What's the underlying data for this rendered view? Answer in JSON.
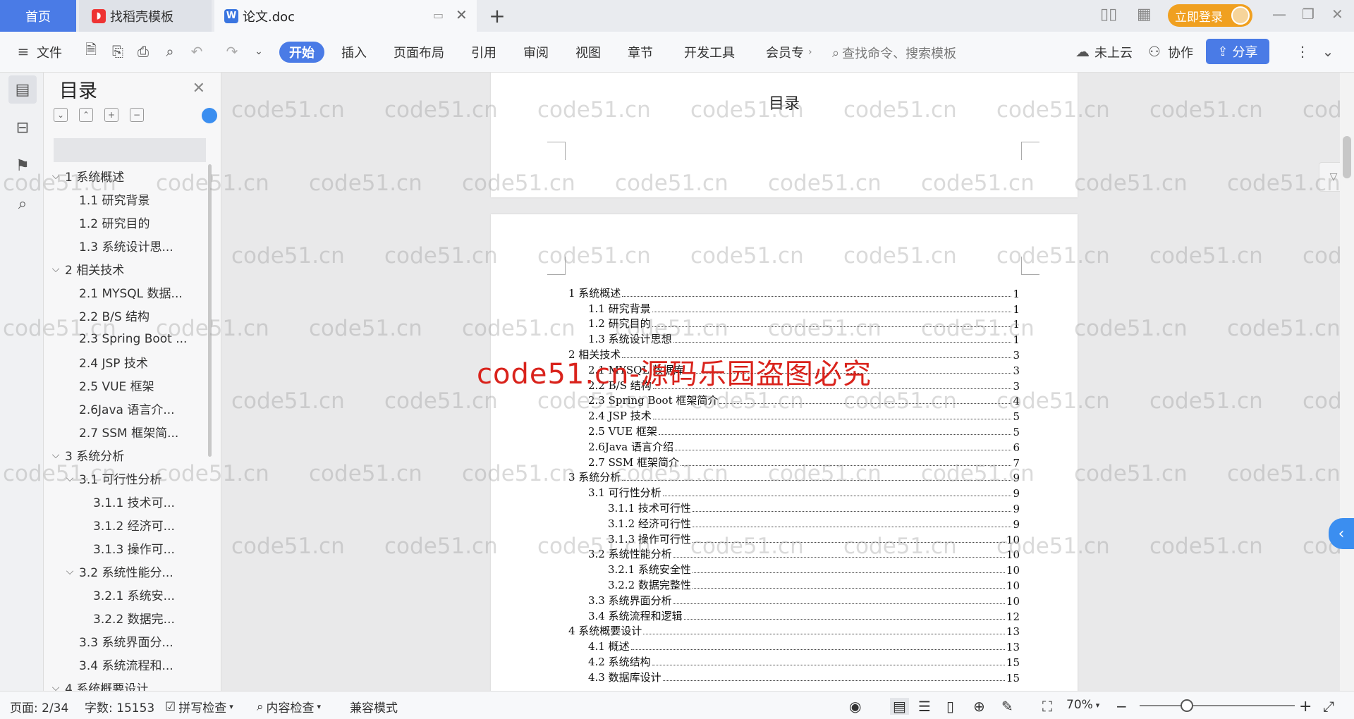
{
  "tabs": {
    "home": "首页",
    "daoke": "找稻壳模板",
    "doc": "论文.doc",
    "add": "+"
  },
  "header": {
    "login": "立即登录"
  },
  "toolbar": {
    "file": "文件",
    "menus": [
      "开始",
      "插入",
      "页面布局",
      "引用",
      "审阅",
      "视图",
      "章节",
      "开发工具",
      "会员专"
    ],
    "search_placeholder": "查找命令、搜索模板",
    "cloud": "未上云",
    "collab": "协作",
    "share": "分享"
  },
  "sidebar": {
    "title": "目录",
    "items": [
      {
        "label": "1 系统概述",
        "level": 1,
        "arrow": "⌵"
      },
      {
        "label": "1.1 研究背景",
        "level": 2,
        "arrow": ""
      },
      {
        "label": "1.2 研究目的",
        "level": 2,
        "arrow": ""
      },
      {
        "label": "1.3 系统设计思...",
        "level": 2,
        "arrow": ""
      },
      {
        "label": "2 相关技术",
        "level": 1,
        "arrow": "⌵"
      },
      {
        "label": "2.1 MYSQL 数据...",
        "level": 2,
        "arrow": ""
      },
      {
        "label": "2.2 B/S 结构",
        "level": 2,
        "arrow": ""
      },
      {
        "label": "2.3 Spring Boot ...",
        "level": 2,
        "arrow": ""
      },
      {
        "label": "2.4 JSP 技术",
        "level": 2,
        "arrow": ""
      },
      {
        "label": "2.5 VUE 框架",
        "level": 2,
        "arrow": ""
      },
      {
        "label": "2.6Java 语言介...",
        "level": 2,
        "arrow": ""
      },
      {
        "label": "2.7 SSM 框架简...",
        "level": 2,
        "arrow": ""
      },
      {
        "label": "3 系统分析",
        "level": 1,
        "arrow": "⌵"
      },
      {
        "label": "3.1 可行性分析",
        "level": 2,
        "arrow": "⌵"
      },
      {
        "label": "3.1.1 技术可...",
        "level": 3,
        "arrow": ""
      },
      {
        "label": "3.1.2 经济可...",
        "level": 3,
        "arrow": ""
      },
      {
        "label": "3.1.3 操作可...",
        "level": 3,
        "arrow": ""
      },
      {
        "label": "3.2 系统性能分...",
        "level": 2,
        "arrow": "⌵"
      },
      {
        "label": "3.2.1 系统安...",
        "level": 3,
        "arrow": ""
      },
      {
        "label": "3.2.2 数据完...",
        "level": 3,
        "arrow": ""
      },
      {
        "label": "3.3 系统界面分...",
        "level": 2,
        "arrow": ""
      },
      {
        "label": "3.4 系统流程和...",
        "level": 2,
        "arrow": ""
      },
      {
        "label": "4 系统概要设计",
        "level": 1,
        "arrow": "⌵"
      }
    ]
  },
  "document": {
    "page1_title": "目录",
    "toc": [
      {
        "text": "1 系统概述",
        "page": "1",
        "indent": 0
      },
      {
        "text": "1.1 研究背景",
        "page": "1",
        "indent": 1
      },
      {
        "text": "1.2 研究目的",
        "page": "1",
        "indent": 1
      },
      {
        "text": "1.3 系统设计思想",
        "page": "1",
        "indent": 1
      },
      {
        "text": "2 相关技术",
        "page": "3",
        "indent": 0
      },
      {
        "text": "2.1 MYSQL 数据库",
        "page": "3",
        "indent": 1
      },
      {
        "text": "2.2 B/S 结构",
        "page": "3",
        "indent": 1
      },
      {
        "text": "2.3 Spring Boot 框架简介",
        "page": "4",
        "indent": 1
      },
      {
        "text": "2.4 JSP 技术",
        "page": "5",
        "indent": 1
      },
      {
        "text": "2.5 VUE 框架",
        "page": "5",
        "indent": 1
      },
      {
        "text": "2.6Java 语言介绍",
        "page": "6",
        "indent": 1
      },
      {
        "text": "2.7 SSM 框架简介",
        "page": "7",
        "indent": 1
      },
      {
        "text": "3 系统分析",
        "page": "9",
        "indent": 0
      },
      {
        "text": "3.1 可行性分析",
        "page": "9",
        "indent": 1
      },
      {
        "text": "3.1.1 技术可行性",
        "page": "9",
        "indent": 2
      },
      {
        "text": "3.1.2 经济可行性",
        "page": "9",
        "indent": 2
      },
      {
        "text": "3.1.3 操作可行性",
        "page": "10",
        "indent": 2
      },
      {
        "text": "3.2 系统性能分析",
        "page": "10",
        "indent": 1
      },
      {
        "text": "3.2.1 系统安全性",
        "page": "10",
        "indent": 2
      },
      {
        "text": "3.2.2 数据完整性",
        "page": "10",
        "indent": 2
      },
      {
        "text": "3.3 系统界面分析",
        "page": "10",
        "indent": 1
      },
      {
        "text": "3.4 系统流程和逻辑",
        "page": "12",
        "indent": 1
      },
      {
        "text": "4 系统概要设计",
        "page": "13",
        "indent": 0
      },
      {
        "text": "4.1 概述",
        "page": "13",
        "indent": 1
      },
      {
        "text": "4.2 系统结构",
        "page": "15",
        "indent": 1
      },
      {
        "text": "4.3 数据库设计",
        "page": "15",
        "indent": 1
      }
    ]
  },
  "watermark": {
    "small": "code51.cn",
    "big": "code51.cn-源码乐园盗图必究"
  },
  "status": {
    "page": "页面: 2/34",
    "words": "字数: 15153",
    "spell": "拼写检查",
    "content_check": "内容检查",
    "compat": "兼容模式",
    "zoom": "70%"
  },
  "colors": {
    "accent": "#4a7be6",
    "login": "#f0a020",
    "watermark_red": "#d9231c"
  }
}
